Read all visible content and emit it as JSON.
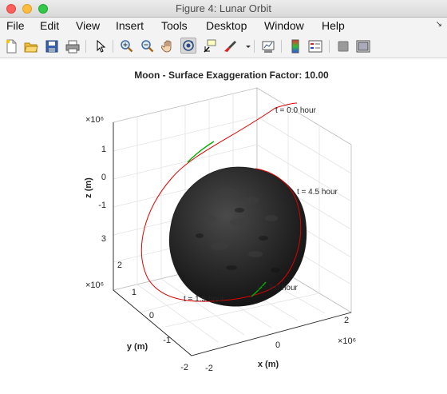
{
  "window": {
    "title": "Figure 4: Lunar Orbit"
  },
  "menubar": {
    "items": [
      "File",
      "Edit",
      "View",
      "Insert",
      "Tools",
      "Desktop",
      "Window",
      "Help"
    ]
  },
  "toolbar": {
    "buttons": [
      "new-figure-icon",
      "open-file-icon",
      "save-icon",
      "print-icon",
      "edit-plot-pointer-icon",
      "zoom-in-icon",
      "zoom-out-icon",
      "pan-hand-icon",
      "rotate-3d-icon",
      "data-cursor-icon",
      "brush-icon",
      "dropdown-arrow-icon",
      "link-plot-icon",
      "insert-colorbar-icon",
      "insert-legend-icon",
      "hide-plot-tools-icon",
      "show-plot-tools-icon"
    ],
    "active": "rotate-3d-icon"
  },
  "plot": {
    "title": "Moon - Surface Exaggeration Factor: 10.00",
    "xlabel": "x (m)",
    "ylabel": "y (m)",
    "zlabel": "z (m)",
    "x_exponent": "×10⁶",
    "y_exponent": "×10⁶",
    "z_exponent": "×10⁶",
    "x_ticks": [
      "-2",
      "0",
      "2"
    ],
    "y_ticks": [
      "-2",
      "-1",
      "0",
      "1",
      "2",
      "3"
    ],
    "z_ticks": [
      "1",
      "0",
      "-1"
    ],
    "annotations": [
      "t = 0.0 hour",
      "t = 4.5 hour",
      "t = 1.5 hour",
      "t = 3.0 hour"
    ],
    "orbit_color": "#e00000",
    "ground_track_color": "#00b000",
    "moon_color": "#2a2a2a"
  }
}
